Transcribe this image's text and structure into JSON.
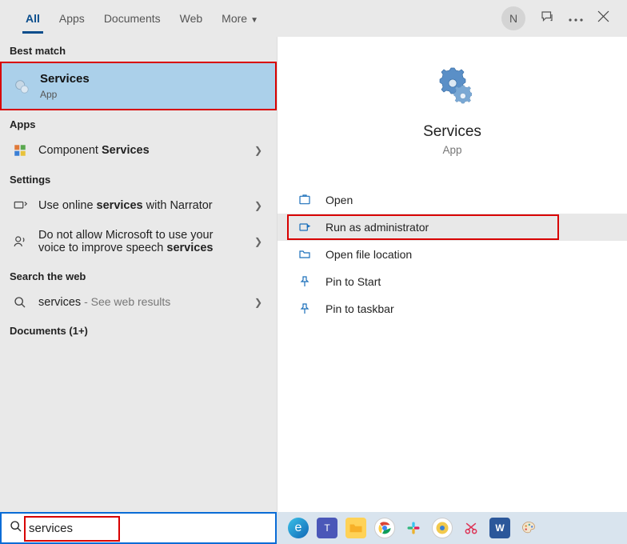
{
  "tabs": {
    "all": "All",
    "apps": "Apps",
    "documents": "Documents",
    "web": "Web",
    "more": "More"
  },
  "avatar_initial": "N",
  "best_match_header": "Best match",
  "best_match": {
    "title": "Services",
    "sub": "App"
  },
  "apps_header": "Apps",
  "apps_item_prefix": "Component ",
  "apps_item_bold": "Services",
  "settings_header": "Settings",
  "setting1_prefix": "Use online ",
  "setting1_bold": "services",
  "setting1_suffix": " with Narrator",
  "setting2_prefix": "Do not allow Microsoft to use your voice to improve speech ",
  "setting2_bold": "services",
  "search_web_header": "Search the web",
  "web_item_term": "services",
  "web_item_suffix": " - See web results",
  "documents_header": "Documents (1+)",
  "preview": {
    "title": "Services",
    "sub": "App"
  },
  "actions": {
    "open": "Open",
    "run_admin": "Run as administrator",
    "open_loc": "Open file location",
    "pin_start": "Pin to Start",
    "pin_taskbar": "Pin to taskbar"
  },
  "search_value": "services"
}
